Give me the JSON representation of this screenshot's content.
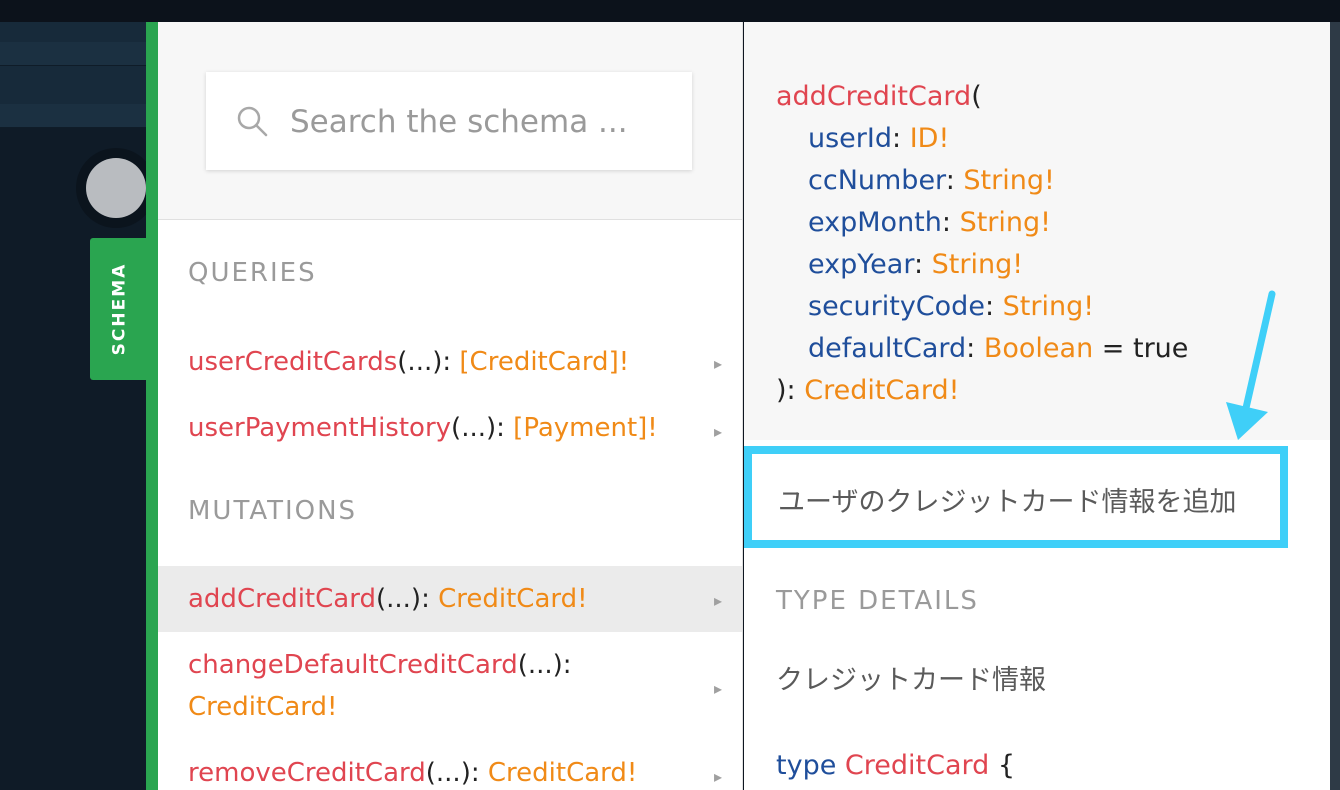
{
  "sidebar": {
    "schema_tab_label": "SCHEMA"
  },
  "search": {
    "placeholder": "Search the schema ..."
  },
  "queries": {
    "title": "QUERIES",
    "items": [
      {
        "name": "userCreditCards",
        "args": "(...)",
        "sep": ": ",
        "type": "[CreditCard]!"
      },
      {
        "name": "userPaymentHistory",
        "args": "(...)",
        "sep": ": ",
        "type": "[Payment]!"
      }
    ]
  },
  "mutations": {
    "title": "MUTATIONS",
    "items": [
      {
        "name": "addCreditCard",
        "args": "(...)",
        "sep": ": ",
        "type": "CreditCard!"
      },
      {
        "name": "changeDefaultCreditCard",
        "args": "(...)",
        "sep": ":",
        "type": "CreditCard!"
      },
      {
        "name": "removeCreditCard",
        "args": "(...)",
        "sep": ": ",
        "type": "CreditCard!"
      }
    ]
  },
  "chevron_glyph": "▸",
  "detail": {
    "signature": {
      "name": "addCreditCard",
      "open": "(",
      "args": [
        {
          "name": "userId",
          "colon": ": ",
          "type": "ID!",
          "default": ""
        },
        {
          "name": "ccNumber",
          "colon": ": ",
          "type": "String!",
          "default": ""
        },
        {
          "name": "expMonth",
          "colon": ": ",
          "type": "String!",
          "default": ""
        },
        {
          "name": "expYear",
          "colon": ": ",
          "type": "String!",
          "default": ""
        },
        {
          "name": "securityCode",
          "colon": ": ",
          "type": "String!",
          "default": ""
        },
        {
          "name": "defaultCard",
          "colon": ": ",
          "type": "Boolean",
          "default": " = true"
        }
      ],
      "close": "): ",
      "return_type": "CreditCard!"
    },
    "description": "ユーザのクレジットカード情報を追加",
    "type_details_title": "TYPE DETAILS",
    "type_description": "クレジットカード情報",
    "type_decl": {
      "keyword": "type ",
      "name": "CreditCard",
      "brace": " {"
    }
  },
  "colors": {
    "accent_green": "#2aa550",
    "function_red": "#e04550",
    "type_orange": "#f08a17",
    "arg_blue": "#1f4e9b",
    "highlight_cyan": "#3fcff8"
  }
}
